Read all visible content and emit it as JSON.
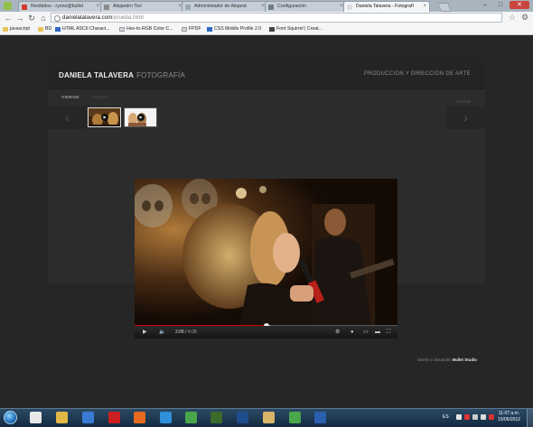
{
  "browser": {
    "tabs": [
      {
        "label": "Recibidos - ryeno@bullet",
        "icon": "gmail-icon",
        "color": "#d33a2c",
        "active": false
      },
      {
        "label": "Alejandro Tori",
        "icon": "person-icon",
        "color": "#8a8a8a",
        "active": false
      },
      {
        "label": "Administrador de Alejand",
        "icon": "page-icon",
        "color": "#9aa6b2",
        "active": false
      },
      {
        "label": "Configuración",
        "icon": "wrench-icon",
        "color": "#6f7c89",
        "active": false
      },
      {
        "label": "Daniela Talavera - Fotografí",
        "icon": "page-icon",
        "color": "#d9dde2",
        "active": true
      }
    ],
    "url_host": "danielatalavera.com",
    "url_path": "/prueba.html",
    "bookmarks": [
      {
        "label": "javascript",
        "icon": "folder"
      },
      {
        "label": "BD",
        "icon": "folder"
      },
      {
        "label": "HTML ASCII Charact...",
        "icon": "blue"
      },
      {
        "label": "Hex-to-RGB Color C...",
        "icon": "page"
      },
      {
        "label": "FPDF",
        "icon": "page"
      },
      {
        "label": "CSS Mobile Profile 2.0",
        "icon": "blue"
      },
      {
        "label": "Font Squirrel | Creat...",
        "icon": "dark"
      }
    ]
  },
  "site": {
    "brand_name": "DANIELA TALAVERA",
    "brand_sub": "FOTOGRAFÍA",
    "tagline": "PRODUCCIÓN Y DIRECCIÓN DE ARTE",
    "tab_videos": "VIDEOS",
    "tab_fotos": "FOTOS",
    "back_label": "ATRAS",
    "prev_glyph": "‹",
    "next_glyph": "›",
    "credit_prefix": "Diseño y desarrollo",
    "credit_studio": "Bullet Studio"
  },
  "player": {
    "current_time": "2:06",
    "duration": "4:08",
    "progress": 0.5,
    "buffered": 0.52
  },
  "taskbar": {
    "language": "ES",
    "time": "11:07 a.m.",
    "date": "15/06/2012",
    "apps": [
      {
        "icon": "excel-icon",
        "color": "#e8e8e8"
      },
      {
        "icon": "explorer-folder-icon",
        "color": "#e3b845"
      },
      {
        "icon": "media-player-icon",
        "color": "#3a7bd5"
      },
      {
        "icon": "opera-icon",
        "color": "#cc1f1f"
      },
      {
        "icon": "firefox-icon",
        "color": "#e66a1f"
      },
      {
        "icon": "internet-explorer-icon",
        "color": "#2f8fd8"
      },
      {
        "icon": "chrome-icon",
        "color": "#4aa64a"
      },
      {
        "icon": "dreamweaver-icon",
        "color": "#3a6b2a"
      },
      {
        "icon": "photoshop-icon",
        "color": "#1f4c8c"
      },
      {
        "icon": "windows-explorer-icon",
        "color": "#d9b56a"
      },
      {
        "icon": "chrome-icon",
        "color": "#4aa64a"
      },
      {
        "icon": "word-icon",
        "color": "#2b5fb0"
      }
    ]
  }
}
